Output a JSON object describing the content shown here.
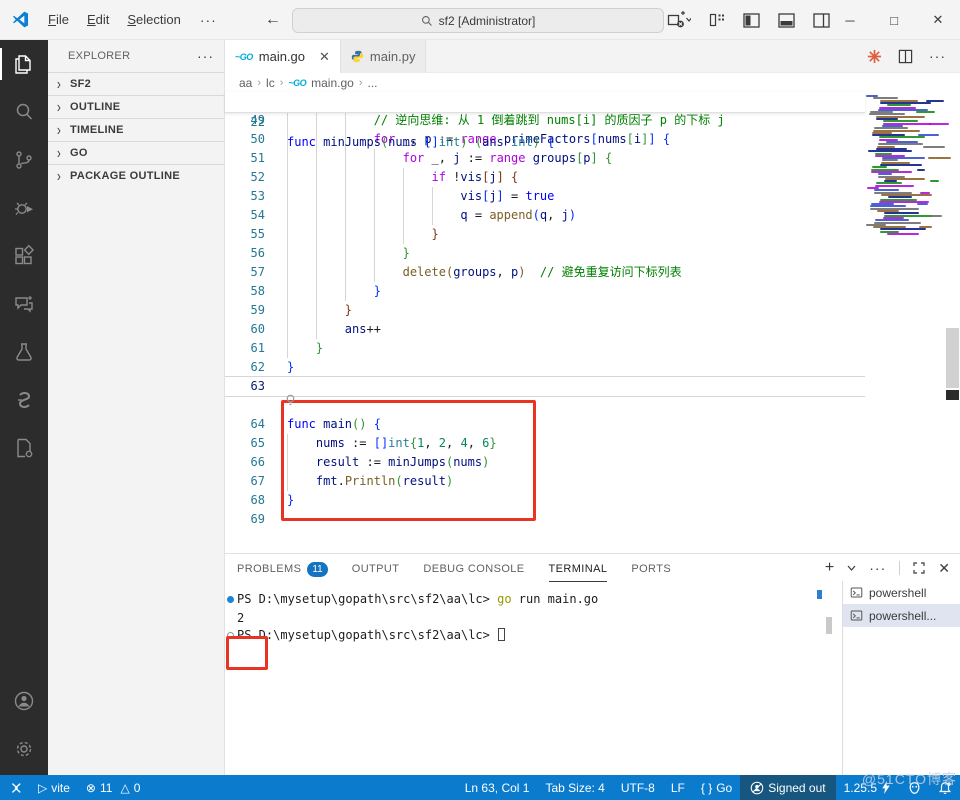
{
  "titlebar": {
    "menus": [
      "File",
      "Edit",
      "Selection"
    ],
    "more_label": "···",
    "search_value": "sf2 [Administrator]"
  },
  "tabs": [
    {
      "label": "main.go",
      "icon": "go",
      "active": true
    },
    {
      "label": "main.py",
      "icon": "python",
      "active": false
    }
  ],
  "editor_actions": {
    "run_icon": "red-asterisk",
    "split_icon": "split-editor",
    "more_icon": "ellipsis"
  },
  "breadcrumb": {
    "items": [
      "aa",
      "lc",
      "main.go",
      "..."
    ]
  },
  "sidebar": {
    "header": "EXPLORER",
    "more_label": "···",
    "sections": [
      "SF2",
      "OUTLINE",
      "TIMELINE",
      "GO",
      "PACKAGE OUTLINE"
    ]
  },
  "activitybar": [
    "explorer",
    "search",
    "source-control",
    "run-and-debug",
    "extensions",
    "chat",
    "testing",
    "go-extension",
    "containers",
    "accounts",
    "settings"
  ],
  "editor": {
    "sticky_line": {
      "n": "22",
      "ind": 0,
      "tok": [
        [
          "func ",
          "k"
        ],
        [
          "minJumps",
          "i"
        ],
        [
          "(",
          "b2"
        ],
        [
          "nums ",
          "i"
        ],
        [
          "[]",
          "b1"
        ],
        [
          "int",
          "t"
        ],
        [
          ") (",
          "b2"
        ],
        [
          "ans ",
          "i"
        ],
        [
          "int",
          "t"
        ],
        [
          ")",
          "b2"
        ],
        [
          " {",
          "b1"
        ]
      ]
    },
    "cursor_line": 63,
    "lines": [
      {
        "n": "49",
        "ind": 12,
        "tok": [
          [
            "// 逆向思维: 从 1 倒着跳到 nums[i] 的质因子 p 的下标 j",
            "m"
          ]
        ]
      },
      {
        "n": "50",
        "ind": 12,
        "tok": [
          [
            "for",
            "c"
          ],
          [
            " ",
            "d"
          ],
          [
            "_",
            "i"
          ],
          [
            ", ",
            "d"
          ],
          [
            "p",
            "i"
          ],
          [
            " := ",
            "d"
          ],
          [
            "range",
            "c"
          ],
          [
            " ",
            "d"
          ],
          [
            "primeFactors",
            "i"
          ],
          [
            "[",
            "b1"
          ],
          [
            "nums",
            "i"
          ],
          [
            "[",
            "b2"
          ],
          [
            "i",
            "i"
          ],
          [
            "]",
            "b2"
          ],
          [
            "]",
            "b1"
          ],
          [
            " {",
            "b1"
          ]
        ]
      },
      {
        "n": "51",
        "ind": 16,
        "tok": [
          [
            "for",
            "c"
          ],
          [
            " ",
            "d"
          ],
          [
            "_",
            "i"
          ],
          [
            ", ",
            "d"
          ],
          [
            "j",
            "i"
          ],
          [
            " := ",
            "d"
          ],
          [
            "range",
            "c"
          ],
          [
            " ",
            "d"
          ],
          [
            "groups",
            "i"
          ],
          [
            "[",
            "b2"
          ],
          [
            "p",
            "i"
          ],
          [
            "]",
            "b2"
          ],
          [
            " {",
            "b2"
          ]
        ]
      },
      {
        "n": "52",
        "ind": 20,
        "tok": [
          [
            "if",
            "c"
          ],
          [
            " !",
            "d"
          ],
          [
            "vis",
            "i"
          ],
          [
            "[",
            "b3"
          ],
          [
            "j",
            "i"
          ],
          [
            "]",
            "b3"
          ],
          [
            " {",
            "b3"
          ]
        ]
      },
      {
        "n": "53",
        "ind": 24,
        "tok": [
          [
            "vis",
            "i"
          ],
          [
            "[",
            "b1"
          ],
          [
            "j",
            "i"
          ],
          [
            "]",
            "b1"
          ],
          [
            " = ",
            "d"
          ],
          [
            "true",
            "k"
          ]
        ]
      },
      {
        "n": "54",
        "ind": 24,
        "tok": [
          [
            "q",
            "i"
          ],
          [
            " = ",
            "d"
          ],
          [
            "append",
            "f"
          ],
          [
            "(",
            "b1"
          ],
          [
            "q",
            "i"
          ],
          [
            ", ",
            "d"
          ],
          [
            "j",
            "i"
          ],
          [
            ")",
            "b1"
          ]
        ]
      },
      {
        "n": "55",
        "ind": 20,
        "tok": [
          [
            "}",
            "b3"
          ]
        ]
      },
      {
        "n": "56",
        "ind": 16,
        "tok": [
          [
            "}",
            "b2"
          ]
        ]
      },
      {
        "n": "57",
        "ind": 16,
        "tok": [
          [
            "delete",
            "f"
          ],
          [
            "(",
            "f"
          ],
          [
            "groups",
            "i"
          ],
          [
            ", ",
            "d"
          ],
          [
            "p",
            "i"
          ],
          [
            ")",
            "f"
          ],
          [
            "  ",
            "d"
          ],
          [
            "// 避免重复访问下标列表",
            "m"
          ]
        ]
      },
      {
        "n": "58",
        "ind": 12,
        "tok": [
          [
            "}",
            "b1"
          ]
        ]
      },
      {
        "n": "59",
        "ind": 8,
        "tok": [
          [
            "}",
            "b3"
          ]
        ]
      },
      {
        "n": "60",
        "ind": 8,
        "tok": [
          [
            "ans",
            "i"
          ],
          [
            "++",
            "d"
          ]
        ]
      },
      {
        "n": "61",
        "ind": 4,
        "tok": [
          [
            "}",
            "b2"
          ]
        ]
      },
      {
        "n": "62",
        "ind": 0,
        "tok": [
          [
            "}",
            "b1"
          ]
        ]
      },
      {
        "n": "63",
        "ind": 0,
        "tok": []
      },
      {
        "n": "64",
        "ind": 0,
        "gap": true,
        "tok": [
          [
            "func ",
            "k"
          ],
          [
            "main",
            "i"
          ],
          [
            "()",
            "b2"
          ],
          [
            " {",
            "b1"
          ]
        ]
      },
      {
        "n": "65",
        "ind": 4,
        "tok": [
          [
            "nums",
            "i"
          ],
          [
            " := ",
            "d"
          ],
          [
            "[]",
            "b1"
          ],
          [
            "int",
            "t"
          ],
          [
            "{",
            "b2"
          ],
          [
            "1",
            "n"
          ],
          [
            ", ",
            "d"
          ],
          [
            "2",
            "n"
          ],
          [
            ", ",
            "d"
          ],
          [
            "4",
            "n"
          ],
          [
            ", ",
            "d"
          ],
          [
            "6",
            "n"
          ],
          [
            "}",
            "b2"
          ]
        ]
      },
      {
        "n": "66",
        "ind": 4,
        "tok": [
          [
            "result",
            "i"
          ],
          [
            " := ",
            "d"
          ],
          [
            "minJumps",
            "i"
          ],
          [
            "(",
            "b2"
          ],
          [
            "nums",
            "i"
          ],
          [
            ")",
            "b2"
          ]
        ]
      },
      {
        "n": "67",
        "ind": 4,
        "tok": [
          [
            "fmt",
            "i"
          ],
          [
            ".",
            "d"
          ],
          [
            "Println",
            "f"
          ],
          [
            "(",
            "b2"
          ],
          [
            "result",
            "i"
          ],
          [
            ")",
            "b2"
          ]
        ]
      },
      {
        "n": "68",
        "ind": 0,
        "tok": [
          [
            "}",
            "b1"
          ]
        ]
      },
      {
        "n": "69",
        "ind": 0,
        "tok": []
      }
    ]
  },
  "panel": {
    "tabs": [
      {
        "label": "PROBLEMS",
        "badge": "11"
      },
      {
        "label": "OUTPUT"
      },
      {
        "label": "DEBUG CONSOLE"
      },
      {
        "label": "TERMINAL",
        "active": true
      },
      {
        "label": "PORTS"
      }
    ],
    "terminal": {
      "lines": [
        {
          "deco": "filled",
          "tok": [
            [
              "PS D:\\mysetup\\gopath\\src\\sf2\\aa\\lc> ",
              "d"
            ],
            [
              "go",
              "y"
            ],
            [
              " run main.go",
              "d"
            ]
          ]
        },
        {
          "tok": [
            [
              "2",
              "d"
            ]
          ]
        },
        {
          "deco": "outline",
          "tok": [
            [
              "PS D:\\mysetup\\gopath\\src\\sf2\\aa\\lc> ",
              "d"
            ]
          ],
          "cursor": true
        }
      ],
      "list": [
        {
          "label": "powershell",
          "selected": false
        },
        {
          "label": "powershell...",
          "selected": true
        }
      ]
    }
  },
  "statusbar": {
    "run_label": "vite",
    "errors": "11",
    "warnings": "0",
    "ln_col": "Ln 63, Col 1",
    "tab_size": "Tab Size: 4",
    "encoding": "UTF-8",
    "eol": "LF",
    "lang_braces": "{ }",
    "language": "Go",
    "signed_out": "Signed out",
    "version": "1.25.5"
  },
  "watermark": "@51CTO博客",
  "colors": {
    "statusbar_bg": "#0b7bce",
    "statusbar_dark_section": "#17567f",
    "badge_bg": "#1673c1",
    "annotation_red": "#e93323",
    "terminal_deco_blue": "#1a85d6",
    "code": {
      "k": "#0000ff",
      "c": "#af00db",
      "i": "#001080",
      "f": "#795e26",
      "t": "#267f99",
      "n": "#098658",
      "m": "#008000",
      "d": "#1b1b1b",
      "b1": "#0431fa",
      "b2": "#319331",
      "b3": "#7b3814"
    },
    "terminal": {
      "d": "#1d1d1d",
      "y": "#949800"
    }
  }
}
